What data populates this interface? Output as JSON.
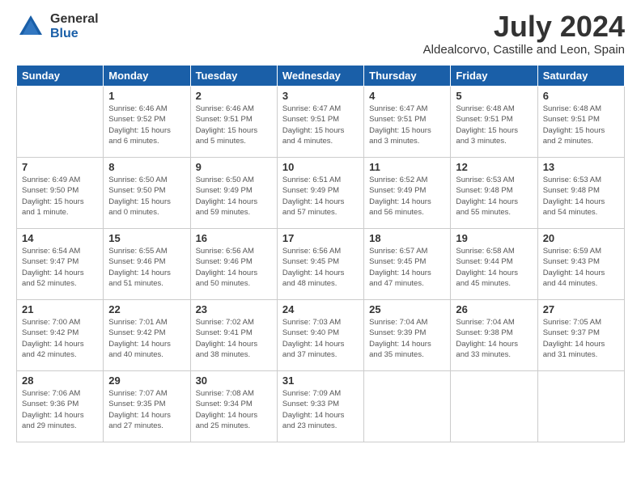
{
  "header": {
    "logo_general": "General",
    "logo_blue": "Blue",
    "month_year": "July 2024",
    "location": "Aldealcorvo, Castille and Leon, Spain"
  },
  "days_of_week": [
    "Sunday",
    "Monday",
    "Tuesday",
    "Wednesday",
    "Thursday",
    "Friday",
    "Saturday"
  ],
  "weeks": [
    [
      {
        "day": "",
        "info": ""
      },
      {
        "day": "1",
        "info": "Sunrise: 6:46 AM\nSunset: 9:52 PM\nDaylight: 15 hours\nand 6 minutes."
      },
      {
        "day": "2",
        "info": "Sunrise: 6:46 AM\nSunset: 9:51 PM\nDaylight: 15 hours\nand 5 minutes."
      },
      {
        "day": "3",
        "info": "Sunrise: 6:47 AM\nSunset: 9:51 PM\nDaylight: 15 hours\nand 4 minutes."
      },
      {
        "day": "4",
        "info": "Sunrise: 6:47 AM\nSunset: 9:51 PM\nDaylight: 15 hours\nand 3 minutes."
      },
      {
        "day": "5",
        "info": "Sunrise: 6:48 AM\nSunset: 9:51 PM\nDaylight: 15 hours\nand 3 minutes."
      },
      {
        "day": "6",
        "info": "Sunrise: 6:48 AM\nSunset: 9:51 PM\nDaylight: 15 hours\nand 2 minutes."
      }
    ],
    [
      {
        "day": "7",
        "info": "Sunrise: 6:49 AM\nSunset: 9:50 PM\nDaylight: 15 hours\nand 1 minute."
      },
      {
        "day": "8",
        "info": "Sunrise: 6:50 AM\nSunset: 9:50 PM\nDaylight: 15 hours\nand 0 minutes."
      },
      {
        "day": "9",
        "info": "Sunrise: 6:50 AM\nSunset: 9:49 PM\nDaylight: 14 hours\nand 59 minutes."
      },
      {
        "day": "10",
        "info": "Sunrise: 6:51 AM\nSunset: 9:49 PM\nDaylight: 14 hours\nand 57 minutes."
      },
      {
        "day": "11",
        "info": "Sunrise: 6:52 AM\nSunset: 9:49 PM\nDaylight: 14 hours\nand 56 minutes."
      },
      {
        "day": "12",
        "info": "Sunrise: 6:53 AM\nSunset: 9:48 PM\nDaylight: 14 hours\nand 55 minutes."
      },
      {
        "day": "13",
        "info": "Sunrise: 6:53 AM\nSunset: 9:48 PM\nDaylight: 14 hours\nand 54 minutes."
      }
    ],
    [
      {
        "day": "14",
        "info": "Sunrise: 6:54 AM\nSunset: 9:47 PM\nDaylight: 14 hours\nand 52 minutes."
      },
      {
        "day": "15",
        "info": "Sunrise: 6:55 AM\nSunset: 9:46 PM\nDaylight: 14 hours\nand 51 minutes."
      },
      {
        "day": "16",
        "info": "Sunrise: 6:56 AM\nSunset: 9:46 PM\nDaylight: 14 hours\nand 50 minutes."
      },
      {
        "day": "17",
        "info": "Sunrise: 6:56 AM\nSunset: 9:45 PM\nDaylight: 14 hours\nand 48 minutes."
      },
      {
        "day": "18",
        "info": "Sunrise: 6:57 AM\nSunset: 9:45 PM\nDaylight: 14 hours\nand 47 minutes."
      },
      {
        "day": "19",
        "info": "Sunrise: 6:58 AM\nSunset: 9:44 PM\nDaylight: 14 hours\nand 45 minutes."
      },
      {
        "day": "20",
        "info": "Sunrise: 6:59 AM\nSunset: 9:43 PM\nDaylight: 14 hours\nand 44 minutes."
      }
    ],
    [
      {
        "day": "21",
        "info": "Sunrise: 7:00 AM\nSunset: 9:42 PM\nDaylight: 14 hours\nand 42 minutes."
      },
      {
        "day": "22",
        "info": "Sunrise: 7:01 AM\nSunset: 9:42 PM\nDaylight: 14 hours\nand 40 minutes."
      },
      {
        "day": "23",
        "info": "Sunrise: 7:02 AM\nSunset: 9:41 PM\nDaylight: 14 hours\nand 38 minutes."
      },
      {
        "day": "24",
        "info": "Sunrise: 7:03 AM\nSunset: 9:40 PM\nDaylight: 14 hours\nand 37 minutes."
      },
      {
        "day": "25",
        "info": "Sunrise: 7:04 AM\nSunset: 9:39 PM\nDaylight: 14 hours\nand 35 minutes."
      },
      {
        "day": "26",
        "info": "Sunrise: 7:04 AM\nSunset: 9:38 PM\nDaylight: 14 hours\nand 33 minutes."
      },
      {
        "day": "27",
        "info": "Sunrise: 7:05 AM\nSunset: 9:37 PM\nDaylight: 14 hours\nand 31 minutes."
      }
    ],
    [
      {
        "day": "28",
        "info": "Sunrise: 7:06 AM\nSunset: 9:36 PM\nDaylight: 14 hours\nand 29 minutes."
      },
      {
        "day": "29",
        "info": "Sunrise: 7:07 AM\nSunset: 9:35 PM\nDaylight: 14 hours\nand 27 minutes."
      },
      {
        "day": "30",
        "info": "Sunrise: 7:08 AM\nSunset: 9:34 PM\nDaylight: 14 hours\nand 25 minutes."
      },
      {
        "day": "31",
        "info": "Sunrise: 7:09 AM\nSunset: 9:33 PM\nDaylight: 14 hours\nand 23 minutes."
      },
      {
        "day": "",
        "info": ""
      },
      {
        "day": "",
        "info": ""
      },
      {
        "day": "",
        "info": ""
      }
    ]
  ]
}
